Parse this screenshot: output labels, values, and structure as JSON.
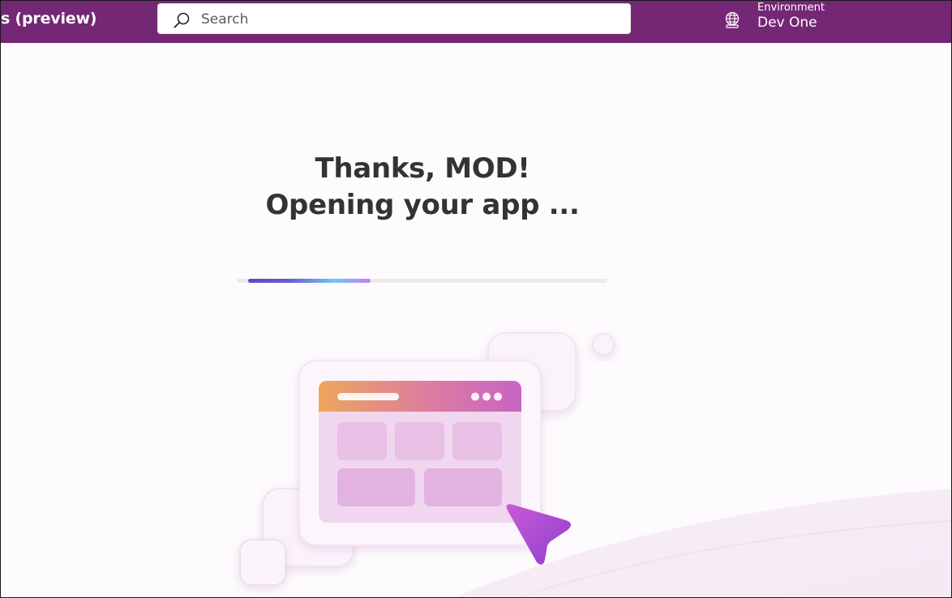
{
  "header": {
    "app_title": "s (preview)",
    "search_placeholder": "Search",
    "environment_label": "Environment",
    "environment_name": "Dev One",
    "brand_color": "#742774"
  },
  "main": {
    "heading_line1": "Thanks, MOD!",
    "heading_line2": "Opening your app ...",
    "progress_fraction": 0.33
  },
  "icons": [
    "search-icon",
    "globe-icon",
    "app-window-illustration",
    "cursor-arrow-icon"
  ]
}
